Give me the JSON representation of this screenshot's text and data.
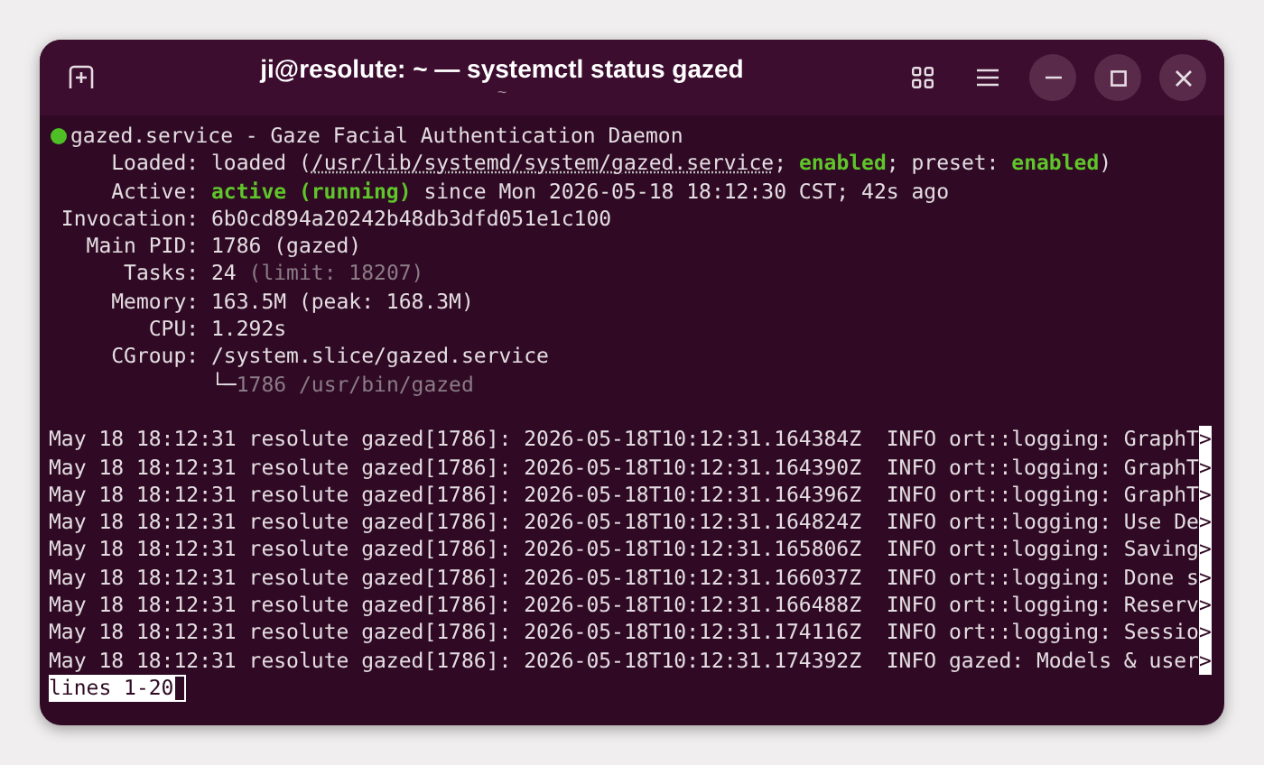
{
  "window": {
    "title": "ji@resolute: ~ — systemctl status gazed",
    "subtitle": "~"
  },
  "unit": {
    "color": "#4fbf26",
    "heading": "gazed.service - Gaze Facial Authentication Daemon"
  },
  "status_lines": [
    {
      "label": "Loaded:",
      "segments": [
        {
          "text": "loaded (",
          "kind": "plain"
        },
        {
          "text": "/usr/lib/systemd/system/gazed.service",
          "kind": "link"
        },
        {
          "text": "; ",
          "kind": "plain"
        },
        {
          "text": "enabled",
          "kind": "good"
        },
        {
          "text": "; preset: ",
          "kind": "plain"
        },
        {
          "text": "enabled",
          "kind": "good"
        },
        {
          "text": ")",
          "kind": "plain"
        }
      ]
    },
    {
      "label": "Active:",
      "segments": [
        {
          "text": "active (running)",
          "kind": "good"
        },
        {
          "text": " since Mon 2026-05-18 18:12:30 CST; 42s ago",
          "kind": "plain"
        }
      ]
    },
    {
      "label": "Invocation:",
      "segments": [
        {
          "text": "6b0cd894a20242b48db3dfd051e1c100",
          "kind": "plain"
        }
      ]
    },
    {
      "label": "Main PID:",
      "segments": [
        {
          "text": "1786 (gazed)",
          "kind": "plain"
        }
      ]
    },
    {
      "label": "Tasks:",
      "segments": [
        {
          "text": "24 ",
          "kind": "plain"
        },
        {
          "text": "(limit: 18207)",
          "kind": "dim"
        }
      ]
    },
    {
      "label": "Memory:",
      "segments": [
        {
          "text": "163.5M (peak: 168.3M)",
          "kind": "plain"
        }
      ]
    },
    {
      "label": "CPU:",
      "segments": [
        {
          "text": "1.292s",
          "kind": "plain"
        }
      ]
    },
    {
      "label": "CGroup:",
      "segments": [
        {
          "text": "/system.slice/gazed.service",
          "kind": "plain"
        }
      ]
    },
    {
      "segments": [
        {
          "text": "└─",
          "kind": "plain"
        },
        {
          "text": "1786 /usr/bin/gazed",
          "kind": "dim"
        }
      ]
    }
  ],
  "log_lines": [
    {
      "text": "May 18 18:12:31 resolute gazed[1786]: 2026-05-18T10:12:31.164384Z  INFO ort::logging: GraphT",
      "marker": ">"
    },
    {
      "text": "May 18 18:12:31 resolute gazed[1786]: 2026-05-18T10:12:31.164390Z  INFO ort::logging: GraphT",
      "marker": ">"
    },
    {
      "text": "May 18 18:12:31 resolute gazed[1786]: 2026-05-18T10:12:31.164396Z  INFO ort::logging: GraphT",
      "marker": ">"
    },
    {
      "text": "May 18 18:12:31 resolute gazed[1786]: 2026-05-18T10:12:31.164824Z  INFO ort::logging: Use De",
      "marker": ">"
    },
    {
      "text": "May 18 18:12:31 resolute gazed[1786]: 2026-05-18T10:12:31.165806Z  INFO ort::logging: Saving",
      "marker": ">"
    },
    {
      "text": "May 18 18:12:31 resolute gazed[1786]: 2026-05-18T10:12:31.166037Z  INFO ort::logging: Done s",
      "marker": ">"
    },
    {
      "text": "May 18 18:12:31 resolute gazed[1786]: 2026-05-18T10:12:31.166488Z  INFO ort::logging: Reserv",
      "marker": ">"
    },
    {
      "text": "May 18 18:12:31 resolute gazed[1786]: 2026-05-18T10:12:31.174116Z  INFO ort::logging: Sessio",
      "marker": ">"
    },
    {
      "text": "May 18 18:12:31 resolute gazed[1786]: 2026-05-18T10:12:31.174392Z  INFO gazed: Models & user",
      "marker": ">"
    }
  ],
  "pager_prompt": "lines 1-20"
}
